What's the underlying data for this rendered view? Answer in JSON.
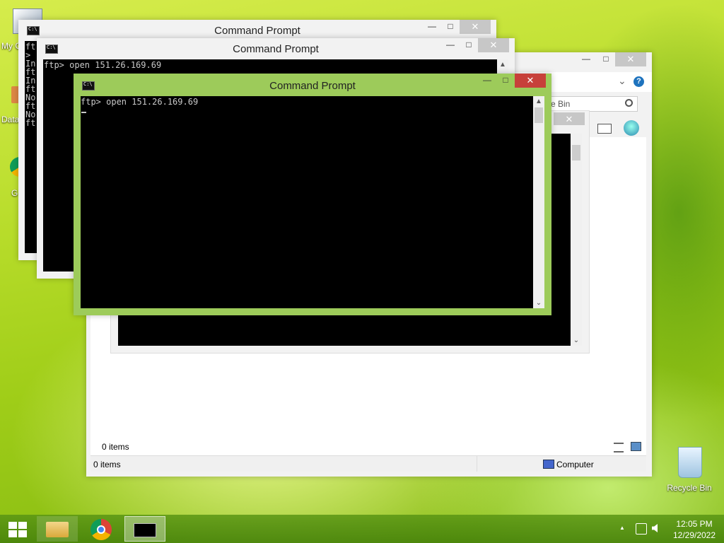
{
  "desktop": {
    "icons": [
      {
        "label": "My C"
      },
      {
        "label": "Data"
      },
      {
        "label": "G"
      },
      {
        "label": "Recycle Bin"
      }
    ]
  },
  "explorer": {
    "search_placeholder": "e Bin",
    "pane_count": "0 items",
    "status_left": "0 items",
    "status_right": "Computer"
  },
  "cmd_back": {
    "title": "Command Prompt",
    "lines": [
      "ft",
      ">",
      "In",
      "ft",
      "In",
      "ft",
      "No",
      "ft",
      "No",
      "ft"
    ]
  },
  "cmd_mid": {
    "title": "Command Prompt",
    "line": "ftp> open 151.26.169.69"
  },
  "cmd_front": {
    "title": "Command Prompt",
    "line": "ftp> open 151.26.169.69"
  },
  "controls": {
    "minimize": "—",
    "maximize": "□",
    "close": "✕",
    "chevron": "⌄",
    "help": "?"
  },
  "tray": {
    "time": "12:05 PM",
    "date": "12/29/2022",
    "chevron": "▲"
  },
  "colors": {
    "active_frame": "#9dcb5a",
    "close_red": "#c7403a",
    "inactive_frame": "#f2f2f2"
  }
}
